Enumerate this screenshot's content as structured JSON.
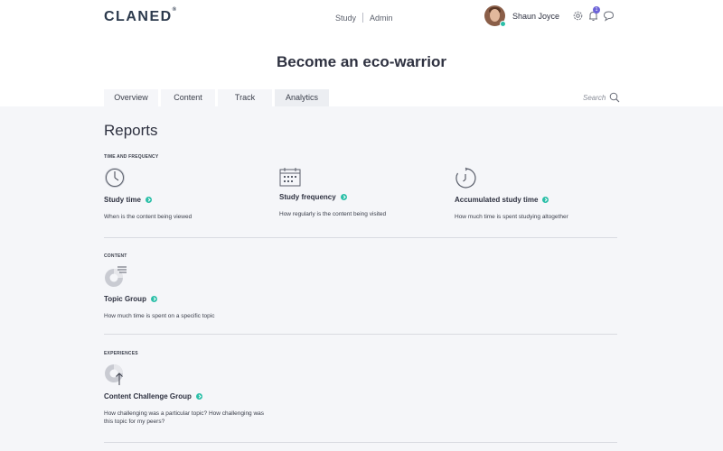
{
  "header": {
    "logo": "CLANED",
    "logo_mark": "®",
    "nav": [
      "Study",
      "Admin"
    ],
    "user_name": "Shaun Joyce",
    "notifications_count": "1",
    "accent_color": "#2bbfa8",
    "badge_color": "#6c63d8"
  },
  "page": {
    "title": "Become an eco-warrior",
    "tabs": [
      "Overview",
      "Content",
      "Track",
      "Analytics"
    ],
    "active_tab": "Analytics",
    "search_placeholder": "Search"
  },
  "reports": {
    "heading": "Reports",
    "sections": [
      {
        "label": "TIME AND FREQUENCY",
        "items": [
          {
            "title": "Study time",
            "description": "When is the content being viewed",
            "icon": "clock-icon"
          },
          {
            "title": "Study frequency",
            "description": "How regularly is the content being visited",
            "icon": "calendar-icon"
          },
          {
            "title": "Accumulated study time",
            "description": "How much time is spent studying altogether",
            "icon": "timer-icon"
          }
        ]
      },
      {
        "label": "CONTENT",
        "items": [
          {
            "title": "Topic Group",
            "description": "How much time is spent on a specific topic",
            "icon": "pie-list-icon"
          }
        ]
      },
      {
        "label": "EXPERIENCES",
        "items": [
          {
            "title": "Content Challenge Group",
            "description": "How challenging was a particular topic? How challenging was this topic for my peers?",
            "icon": "pie-arrow-icon"
          }
        ]
      }
    ]
  }
}
